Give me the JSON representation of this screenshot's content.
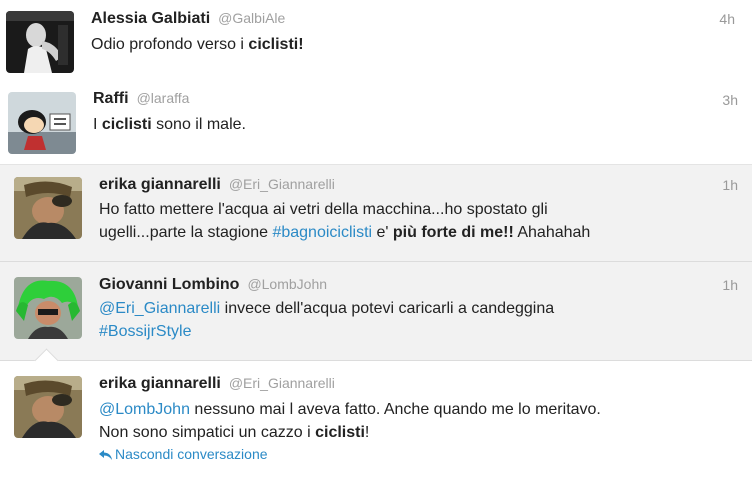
{
  "tweets": [
    {
      "name": "Alessia Galbiati",
      "handle": "@GalbiAle",
      "time": "4h",
      "text": [
        "Odio profondo verso i ",
        {
          "b": "ciclisti!"
        }
      ]
    },
    {
      "name": "Raffi",
      "handle": "@laraffa",
      "time": "3h",
      "text": [
        "I ",
        {
          "b": "ciclisti"
        },
        " sono il male."
      ]
    },
    {
      "name": "erika giannarelli",
      "handle": "@Eri_Giannarelli",
      "time": "1h",
      "lines": [
        [
          "Ho fatto mettere l'acqua ai vetri della macchina...ho spostato gli"
        ],
        [
          "ugelli...parte la stagione ",
          {
            "link": "#bagnoiciclisti"
          },
          " e' ",
          {
            "b": "più forte di me!!"
          },
          " Ahahahah"
        ]
      ]
    },
    {
      "name": "Giovanni Lombino",
      "handle": "@LombJohn",
      "time": "1h",
      "lines": [
        [
          {
            "link": "@Eri_Giannarelli"
          },
          " invece dell'acqua potevi caricarli a candeggina"
        ],
        [
          {
            "link": "#BossijrStyle"
          }
        ]
      ]
    },
    {
      "name": "erika giannarelli",
      "handle": "@Eri_Giannarelli",
      "time": "",
      "lines": [
        [
          {
            "link": "@LombJohn"
          },
          " nessuno mai l aveva fatto. Anche quando me lo meritavo."
        ],
        [
          "Non sono simpatici un cazzo i ",
          {
            "b": "ciclisti"
          },
          "!"
        ]
      ]
    }
  ],
  "actions": {
    "collapse_label": "Nascondi conversazione",
    "collapse_icon": "reply-arrow-icon"
  },
  "colors": {
    "link": "#2b8ac6",
    "conversation_background": "#f2f2f2"
  }
}
